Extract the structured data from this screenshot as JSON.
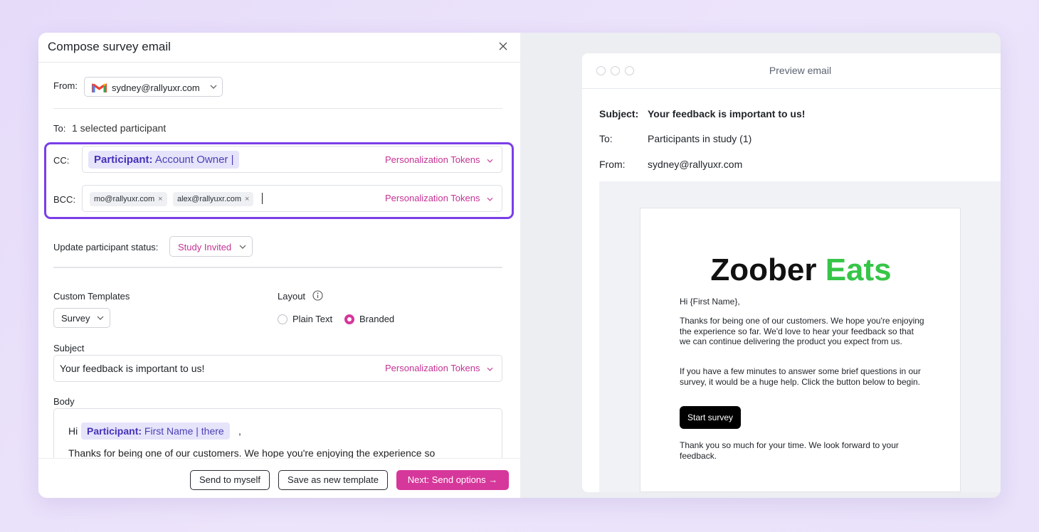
{
  "header": {
    "title": "Compose survey email"
  },
  "from": {
    "label": "From:",
    "value": "sydney@rallyuxr.com"
  },
  "to": {
    "label": "To:",
    "value": "1 selected participant"
  },
  "cc": {
    "label": "CC:",
    "token_prefix": "Participant:",
    "token_value": "Account Owner",
    "token_suffix": "|",
    "tokens_label": "Personalization Tokens"
  },
  "bcc": {
    "label": "BCC:",
    "chips": [
      "mo@rallyuxr.com",
      "alex@rallyuxr.com"
    ],
    "chip_remove": "×",
    "tokens_label": "Personalization Tokens"
  },
  "status": {
    "label": "Update participant status:",
    "value": "Study Invited"
  },
  "templates": {
    "label": "Custom Templates",
    "value": "Survey"
  },
  "layout": {
    "label": "Layout",
    "options": [
      "Plain Text",
      "Branded"
    ],
    "selected": "Branded"
  },
  "subject": {
    "label": "Subject",
    "value": "Your feedback is important to us!",
    "tokens_label": "Personalization Tokens"
  },
  "body": {
    "label": "Body",
    "greeting": "Hi",
    "token_prefix": "Participant:",
    "token_value": "First Name | there",
    "comma": ",",
    "line2": "Thanks for being one of our customers. We hope you're enjoying the experience so"
  },
  "footer": {
    "send_myself": "Send to myself",
    "save_template": "Save as new template",
    "next": "Next: Send options →"
  },
  "preview": {
    "title": "Preview email",
    "subject_label": "Subject:",
    "subject_value": "Your feedback is important to us!",
    "to_label": "To:",
    "to_value": "Participants in study (1)",
    "from_label": "From:",
    "from_value": "sydney@rallyuxr.com",
    "logo_main": "Zoober",
    "logo_accent": "Eats",
    "greeting": "Hi {First Name},",
    "para1": "Thanks for being one of our customers. We hope you're enjoying the experience so far. We'd love to hear your feedback so that we can continue delivering the product you expect from us.",
    "para2": "If you have a few minutes to answer some brief questions in our survey, it would be a huge help. Click the button below to begin.",
    "button": "Start survey",
    "para3": "Thank you so much for your time. We look forward to your feedback."
  },
  "colors": {
    "accent": "#d6379a",
    "highlight_border": "#7a3ee8",
    "token_bg": "#e6e4fb",
    "brand_green": "#37c547"
  }
}
